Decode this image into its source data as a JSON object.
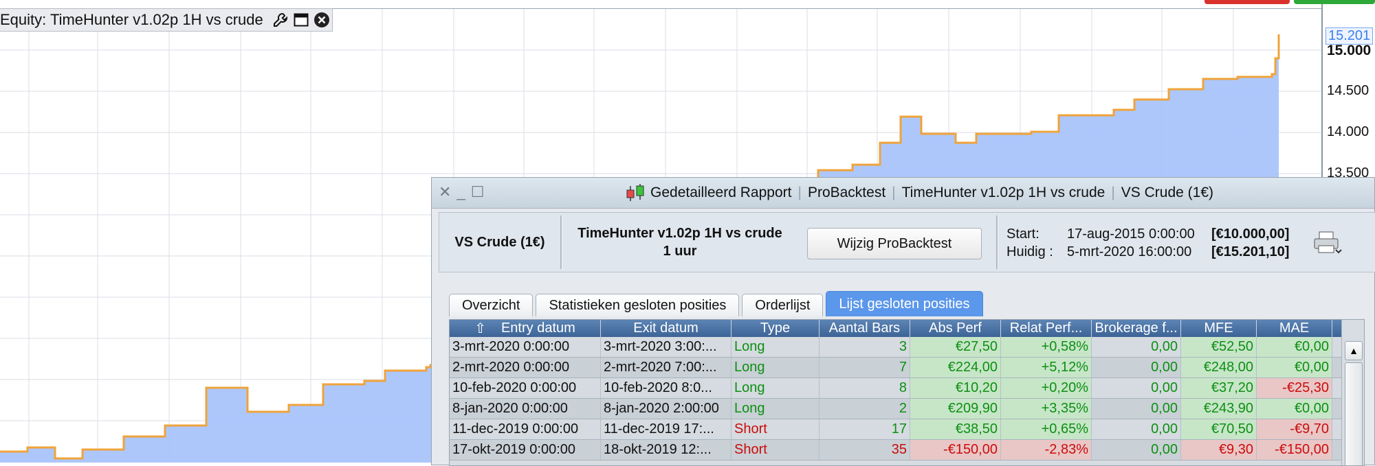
{
  "chart": {
    "title": "Equity: TimeHunter v1.02p 1H vs crude",
    "y_ticks": [
      "15.000",
      "14.500",
      "14.000",
      "13.500"
    ],
    "current_value": "15.201",
    "fill_color": "#a4c1fb",
    "line_color": "#f0a33a",
    "line_alt_color": "#5b8fdc",
    "icons": [
      "wrench-icon",
      "window-icon",
      "close-icon"
    ]
  },
  "report": {
    "title_parts": [
      "Gedetailleerd Rapport",
      "ProBacktest",
      "TimeHunter v1.02p 1H vs crude",
      "VS Crude (1€)"
    ],
    "instrument": "VS Crude (1€)",
    "strategy_name": "TimeHunter v1.02p 1H vs crude",
    "timeframe": "1 uur",
    "edit_button": "Wijzig ProBacktest",
    "start_label": "Start:",
    "start_date": "17-aug-2015 0:00:00",
    "start_value": "[€10.000,00]",
    "current_label": "Huidig :",
    "current_date": "5-mrt-2020 16:00:00",
    "current_value": "[€15.201,10]",
    "tabs": [
      "Overzicht",
      "Statistieken gesloten posities",
      "Orderlijst",
      "Lijst gesloten posities"
    ],
    "active_tab": "Lijst gesloten posities",
    "columns": [
      "Entry datum",
      "Exit datum",
      "Type",
      "Aantal Bars",
      "Abs Perf",
      "Relat Perf...",
      "Brokerage f...",
      "MFE",
      "MAE"
    ],
    "rows": [
      [
        "3-mrt-2020 0:00:00",
        "3-mrt-2020 3:00:...",
        "Long",
        "3",
        "€27,50",
        "+0,58%",
        "0,00",
        "€52,50",
        "€0,00"
      ],
      [
        "2-mrt-2020 0:00:00",
        "2-mrt-2020 7:00:...",
        "Long",
        "7",
        "€224,00",
        "+5,12%",
        "0,00",
        "€248,00",
        "€0,00"
      ],
      [
        "10-feb-2020 0:00:00",
        "10-feb-2020 8:0...",
        "Long",
        "8",
        "€10,20",
        "+0,20%",
        "0,00",
        "€37,20",
        "-€25,30"
      ],
      [
        "8-jan-2020 0:00:00",
        "8-jan-2020 2:00:00",
        "Long",
        "2",
        "€209,90",
        "+3,35%",
        "0,00",
        "€243,90",
        "€0,00"
      ],
      [
        "11-dec-2019 0:00:00",
        "11-dec-2019 17:...",
        "Short",
        "17",
        "€38,50",
        "+0,65%",
        "0,00",
        "€70,50",
        "-€9,70"
      ],
      [
        "17-okt-2019 0:00:00",
        "18-okt-2019 12:...",
        "Short",
        "35",
        "-€150,00",
        "-2,83%",
        "0,00",
        "€9,30",
        "-€150,00"
      ]
    ]
  }
}
